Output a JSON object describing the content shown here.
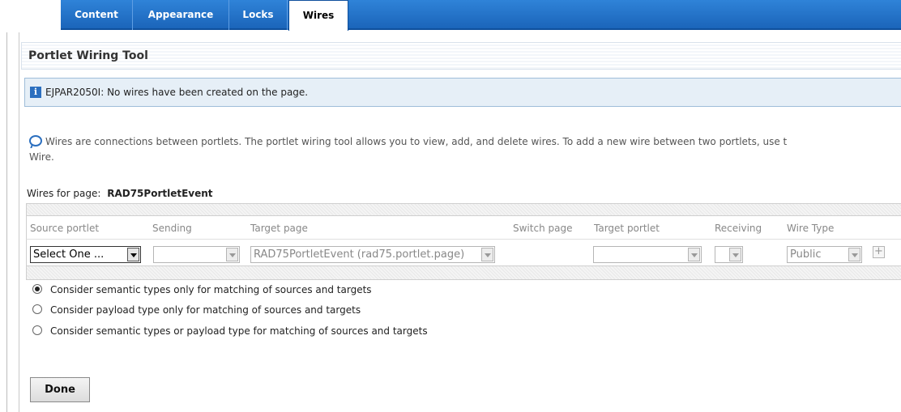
{
  "tabs": [
    {
      "label": "Content",
      "active": false
    },
    {
      "label": "Appearance",
      "active": false
    },
    {
      "label": "Locks",
      "active": false
    },
    {
      "label": "Wires",
      "active": true
    }
  ],
  "portlet": {
    "title": "Portlet Wiring Tool"
  },
  "message": {
    "text": "EJPAR2050I: No wires have been created on the page."
  },
  "help": {
    "text": "Wires are connections between portlets. The portlet wiring tool allows you to view, add, and delete wires. To add a new wire between two portlets, use t",
    "text_line2": "Wire."
  },
  "wires_for": {
    "label": "Wires for page:",
    "page": "RAD75PortletEvent"
  },
  "table": {
    "headers": [
      "Source portlet",
      "Sending",
      "Target page",
      "Switch page",
      "Target portlet",
      "Receiving",
      "Wire Type"
    ],
    "row": {
      "source_portlet": "Select One ...",
      "sending": "",
      "target_page": "RAD75PortletEvent (rad75.portlet.page)",
      "target_portlet": "",
      "receiving": "",
      "wire_type": "Public"
    },
    "add_symbol": "+"
  },
  "options": [
    {
      "label": "Consider semantic types only for matching of sources and targets",
      "checked": true
    },
    {
      "label": "Consider payload type only for matching of sources and targets",
      "checked": false
    },
    {
      "label": "Consider semantic types or payload type for matching of sources and targets",
      "checked": false
    }
  ],
  "done_label": "Done",
  "colors": {
    "tab_bar": "#1f6cc2",
    "message_bg": "#e6eff7",
    "info_icon": "#2b6fbf"
  }
}
